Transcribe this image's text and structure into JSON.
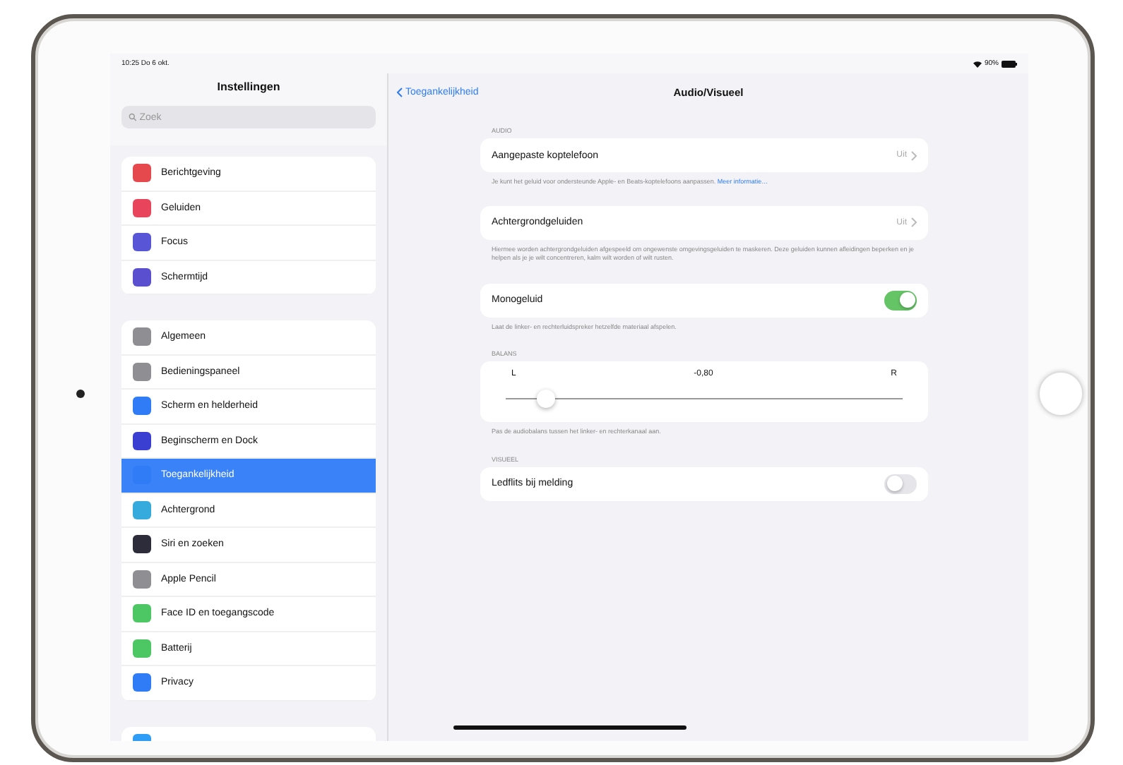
{
  "status_bar": {
    "time": "10:25",
    "date": "Do 6 okt.",
    "battery": "90%"
  },
  "sidebar": {
    "title": "Instellingen",
    "search": {
      "placeholder": "Zoek"
    },
    "groups": [
      {
        "items": [
          {
            "label": "Berichtgeving",
            "color": "#e5484d",
            "selected": false
          },
          {
            "label": "Geluiden",
            "color": "#e8455c",
            "selected": false
          },
          {
            "label": "Focus",
            "color": "#5856d6",
            "selected": false
          },
          {
            "label": "Schermtijd",
            "color": "#5a4fcf",
            "selected": false
          }
        ]
      },
      {
        "items": [
          {
            "label": "Algemeen",
            "color": "#8e8e93",
            "selected": false
          },
          {
            "label": "Bedieningspaneel",
            "color": "#8e8e93",
            "selected": false
          },
          {
            "label": "Scherm en helderheid",
            "color": "#2f7cf6",
            "selected": false
          },
          {
            "label": "Beginscherm en Dock",
            "color": "#3a3fd1",
            "selected": false
          },
          {
            "label": "Toegankelijkheid",
            "color": "#2f7cf6",
            "selected": true
          },
          {
            "label": "Achtergrond",
            "color": "#35aadc",
            "selected": false
          },
          {
            "label": "Siri en zoeken",
            "color": "#2c2c3a",
            "selected": false
          },
          {
            "label": "Apple Pencil",
            "color": "#8e8e93",
            "selected": false
          },
          {
            "label": "Face ID en toegangscode",
            "color": "#4cc764",
            "selected": false
          },
          {
            "label": "Batterij",
            "color": "#4cc764",
            "selected": false
          },
          {
            "label": "Privacy",
            "color": "#2f7cf6",
            "selected": false
          }
        ]
      },
      {
        "items": [
          {
            "color": "#2f9cf6",
            "selected": false
          }
        ]
      }
    ]
  },
  "detail": {
    "back": "Toegankelijkheid",
    "title": "Audio/Visueel",
    "sections": [
      {
        "header": "AUDIO",
        "rows": [
          {
            "kind": "link",
            "label": "Aangepaste koptelefoon",
            "value": "Uit"
          }
        ],
        "footer": "Je kunt het geluid voor ondersteunde Apple- en Beats-koptelefoons aanpassen. **Meer informatie…**"
      },
      {
        "rows": [
          {
            "kind": "link",
            "label": "Achtergrondgeluiden",
            "value": "Uit"
          }
        ],
        "footer": "Hiermee worden achtergrondgeluiden afgespeeld om ongewenste omgevingsgeluiden te maskeren. Deze geluiden kunnen afleidingen beperken en je helpen als je je wilt concentreren, kalm wilt worden of wilt rusten."
      },
      {
        "rows": [
          {
            "kind": "toggle",
            "label": "Monogeluid",
            "on": true
          }
        ],
        "footer": "Laat de linker- en rechterluidspreker hetzelfde materiaal afspelen."
      },
      {
        "header": "BALANS",
        "rows": [
          {
            "kind": "slider",
            "left": "L",
            "reading": "-0,80",
            "right": "R",
            "level": 0.1
          }
        ],
        "footer": "Pas de audiobalans tussen het linker- en rechterkanaal aan."
      },
      {
        "header": "VISUEEL",
        "rows": [
          {
            "kind": "toggle",
            "label": "Ledflits bij melding",
            "on": false
          }
        ]
      }
    ]
  }
}
